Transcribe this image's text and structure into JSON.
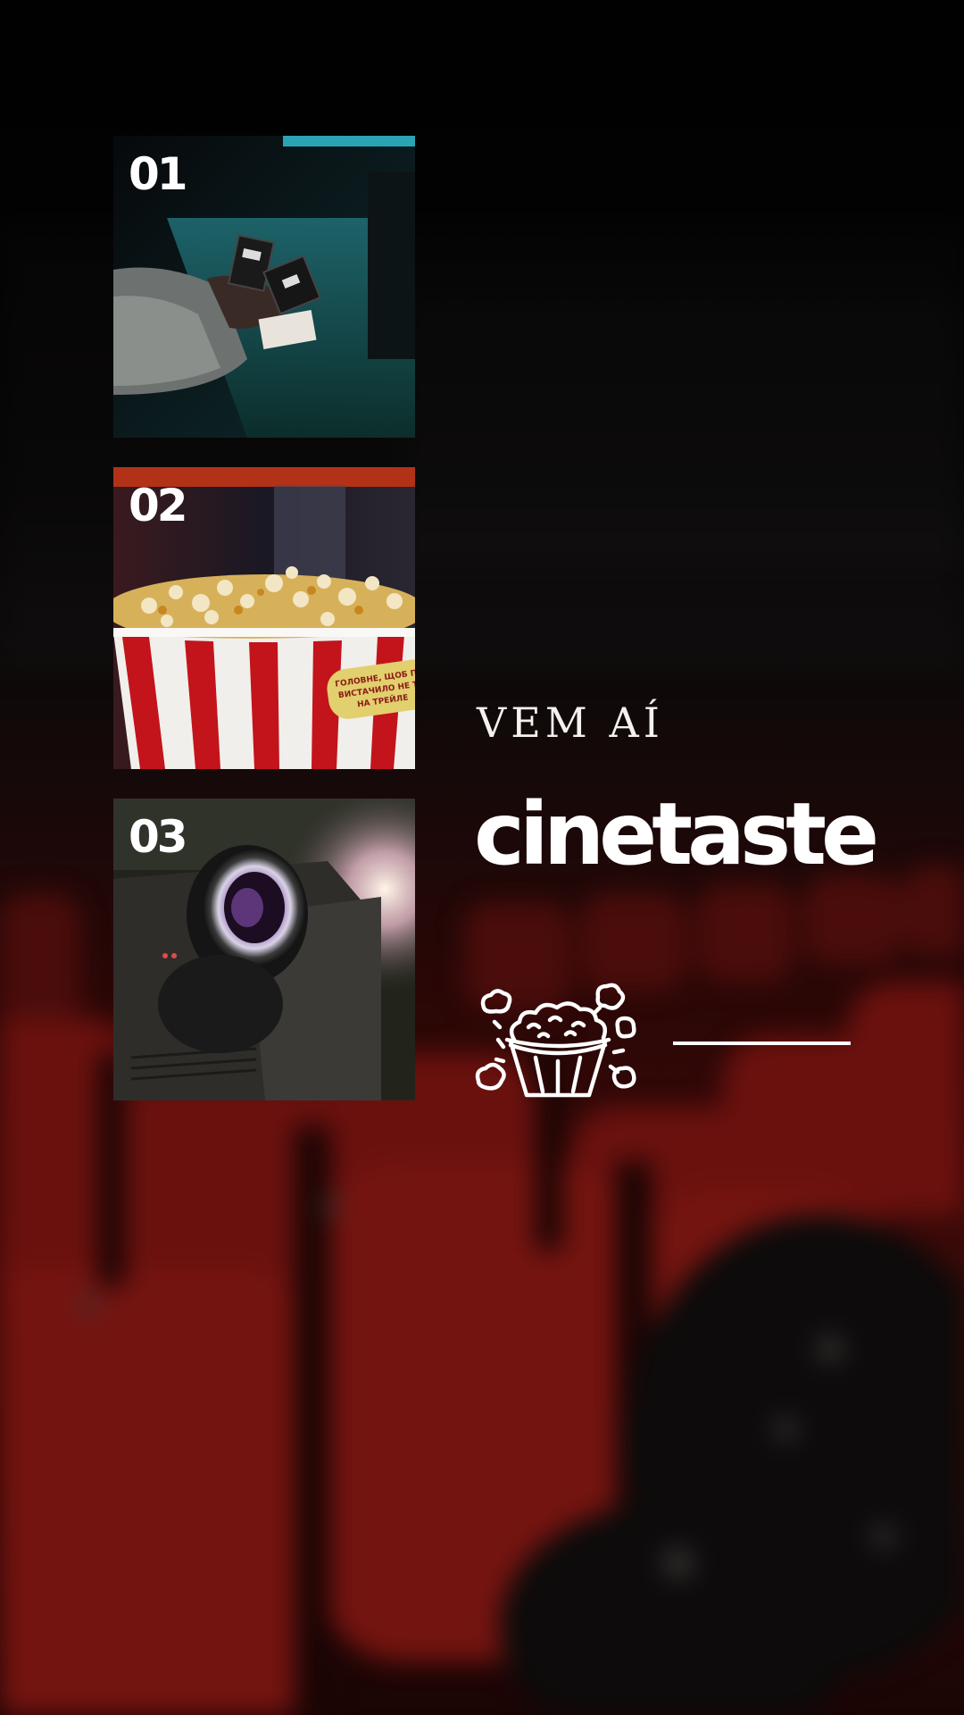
{
  "tiles": [
    {
      "number": "01",
      "subject": "hands-holding-tickets"
    },
    {
      "number": "02",
      "subject": "popcorn-bucket",
      "bucket_text": "ГОЛОВНЕ, ЩОБ ПО ВИСТАЧИЛО НЕ ТР НА ТРЕЙЛЕ"
    },
    {
      "number": "03",
      "subject": "cinema-projector"
    }
  ],
  "headline": {
    "coming_soon": "VEM AÍ",
    "brand": "cinetaste"
  },
  "icons": {
    "popcorn": "popcorn-icon"
  },
  "colors": {
    "seat_red": "#7a1410",
    "text": "#ffffff",
    "background": "#050404"
  }
}
